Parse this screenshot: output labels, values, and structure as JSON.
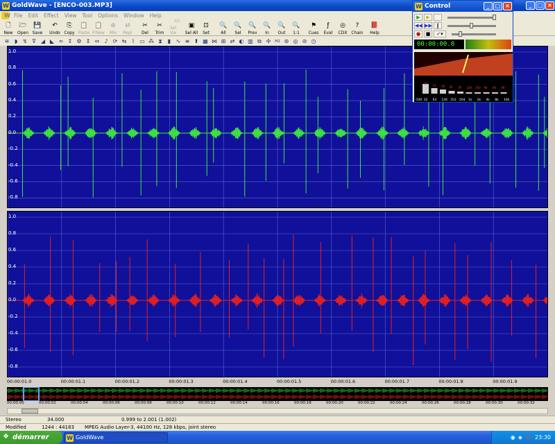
{
  "window": {
    "title": "GoldWave - [ENCO-003.MP3]",
    "icon": "goldwave-icon"
  },
  "menu": [
    "File",
    "Edit",
    "Effect",
    "View",
    "Tool",
    "Options",
    "Window",
    "Help"
  ],
  "toolbar": [
    {
      "label": "New",
      "icon": "new-file-icon",
      "enabled": true
    },
    {
      "label": "Open",
      "icon": "open-folder-icon",
      "enabled": true
    },
    {
      "label": "Save",
      "icon": "save-icon",
      "enabled": true
    },
    {
      "label": "Undo",
      "icon": "undo-icon",
      "enabled": true
    },
    {
      "label": "Copy",
      "icon": "copy-icon",
      "enabled": true
    },
    {
      "label": "Paste",
      "icon": "paste-icon",
      "enabled": false
    },
    {
      "label": "P.New",
      "icon": "paste-new-icon",
      "enabled": false
    },
    {
      "label": "Mix",
      "icon": "mix-icon",
      "enabled": false
    },
    {
      "label": "Repl",
      "icon": "replace-icon",
      "enabled": false
    },
    {
      "label": "Del",
      "icon": "delete-icon",
      "enabled": true
    },
    {
      "label": "Trim",
      "icon": "trim-icon",
      "enabled": true
    },
    {
      "label": "Sel Vw",
      "icon": "select-view-icon",
      "enabled": false
    },
    {
      "label": "Sel All",
      "icon": "select-all-icon",
      "enabled": true
    },
    {
      "label": "Set",
      "icon": "set-icon",
      "enabled": true
    },
    {
      "label": "All",
      "icon": "zoom-all-icon",
      "enabled": true
    },
    {
      "label": "Sel",
      "icon": "zoom-sel-icon",
      "enabled": true
    },
    {
      "label": "Prev",
      "icon": "zoom-prev-icon",
      "enabled": true
    },
    {
      "label": "In",
      "icon": "zoom-in-icon",
      "enabled": true
    },
    {
      "label": "Out",
      "icon": "zoom-out-icon",
      "enabled": true
    },
    {
      "label": "1:1",
      "icon": "zoom-1-1-icon",
      "enabled": true
    },
    {
      "label": "Cues",
      "icon": "cues-icon",
      "enabled": true
    },
    {
      "label": "Eval",
      "icon": "eval-icon",
      "enabled": true
    },
    {
      "label": "CDX",
      "icon": "cdx-icon",
      "enabled": true
    },
    {
      "label": "Chain",
      "icon": "chain-icon",
      "enabled": true
    },
    {
      "label": "Help",
      "icon": "help-icon",
      "enabled": true
    }
  ],
  "waveform": {
    "y_ticks": [
      "1.0",
      "0.8",
      "0.6",
      "0.4",
      "0.2",
      "0.0",
      "-0.2",
      "-0.4",
      "-0.6",
      "-0.8"
    ],
    "left_color": "#3ee83e",
    "right_color": "#e82020",
    "bg_color": "#10109a",
    "time_labels": [
      "00:00:01.0",
      "00:00:01.1",
      "00:00:01.2",
      "00:00:01.3",
      "00:00:01.4",
      "00:00:01.5",
      "00:00:01.6",
      "00:00:01.7",
      "00:00:01.8",
      "00:00:01.9"
    ],
    "overview_labels": [
      "00:00:00",
      "00:00:02",
      "00:00:04",
      "00:00:06",
      "00:00:08",
      "00:00:10",
      "00:00:12",
      "00:00:14",
      "00:00:16",
      "00:00:18",
      "00:00:20",
      "00:00:22",
      "00:00:24",
      "00:00:26",
      "00:00:28",
      "00:00:30",
      "00:00:32"
    ]
  },
  "status": {
    "channels": "Stereo",
    "length": "34.000",
    "selection": "0.999 to 2.001 (1.002)",
    "modified": "Modified",
    "zoom": "1244 : 44183",
    "format": "MPEG Audio Layer-3, 44100 Hz, 128 kbps, joint stereo"
  },
  "control": {
    "title": "Control",
    "time": "00:00:00.0",
    "meter_labels": [
      "L",
      "R"
    ],
    "eq_labels": [
      "-100",
      "32",
      "63",
      "126",
      "252",
      "504",
      "1k",
      "2k",
      "4k",
      "8k",
      "16k"
    ],
    "eq_values": [
      "-54",
      "-51",
      "-45",
      "36",
      "36",
      "100",
      "100",
      "96",
      "96",
      "98"
    ]
  },
  "taskbar": {
    "start": "démarrer",
    "task": "GoldWave",
    "lang": "FR",
    "clock": "23:30"
  }
}
